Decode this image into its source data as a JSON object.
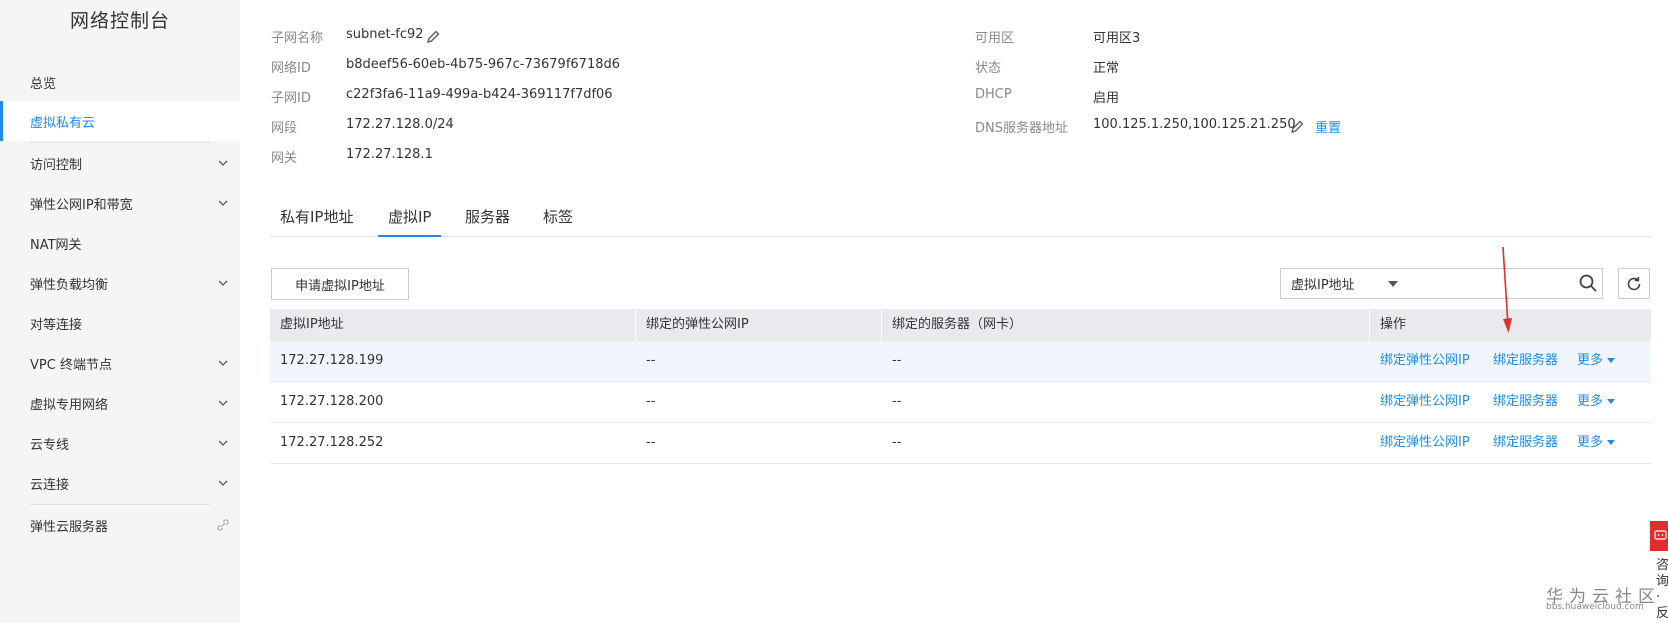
{
  "sidebar": {
    "title": "网络控制台",
    "items": [
      {
        "label": "总览"
      },
      {
        "label": "虚拟私有云"
      },
      {
        "label": "访问控制"
      },
      {
        "label": "弹性公网IP和带宽"
      },
      {
        "label": "NAT网关"
      },
      {
        "label": "弹性负载均衡"
      },
      {
        "label": "对等连接"
      },
      {
        "label": "VPC 终端节点"
      },
      {
        "label": "虚拟专用网络"
      },
      {
        "label": "云专线"
      },
      {
        "label": "云连接"
      },
      {
        "label": "弹性云服务器"
      }
    ]
  },
  "info": {
    "subnet_name_label": "子网名称",
    "subnet_name_value": "subnet-fc92",
    "network_id_label": "网络ID",
    "network_id_value": "b8deef56-60eb-4b75-967c-73679f6718d6",
    "subnet_id_label": "子网ID",
    "subnet_id_value": "c22f3fa6-11a9-499a-b424-369117f7df06",
    "cidr_label": "网段",
    "cidr_value": "172.27.128.0/24",
    "gateway_label": "网关",
    "gateway_value": "172.27.128.1",
    "az_label": "可用区",
    "az_value": "可用区3",
    "status_label": "状态",
    "status_value": "正常",
    "dhcp_label": "DHCP",
    "dhcp_value": "启用",
    "dns_label": "DNS服务器地址",
    "dns_value": "100.125.1.250,100.125.21.250",
    "dns_reset": "重置"
  },
  "tabs": [
    {
      "label": "私有IP地址"
    },
    {
      "label": "虚拟IP"
    },
    {
      "label": "服务器"
    },
    {
      "label": "标签"
    }
  ],
  "toolbar": {
    "apply_button": "申请虚拟IP地址",
    "filter_selected": "虚拟IP地址",
    "search_placeholder": ""
  },
  "table": {
    "headers": [
      "虚拟IP地址",
      "绑定的弹性公网IP",
      "绑定的服务器（网卡）",
      "操作"
    ],
    "rows": [
      {
        "ip": "172.27.128.199",
        "eip": "--",
        "server": "--"
      },
      {
        "ip": "172.27.128.200",
        "eip": "--",
        "server": "--"
      },
      {
        "ip": "172.27.128.252",
        "eip": "--",
        "server": "--"
      }
    ],
    "op_bind_eip": "绑定弹性公网IP",
    "op_bind_server": "绑定服务器",
    "op_more": "更多"
  },
  "float": {
    "consult": "咨询·反"
  },
  "watermark": {
    "line1": "华为云社区",
    "line2": "bbs.huaweicloud.com"
  },
  "colors": {
    "accent": "#1f8ce6",
    "annotation": "#e02d2d"
  }
}
